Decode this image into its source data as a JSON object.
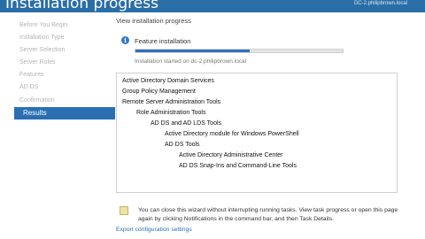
{
  "window": {
    "title": "Installation progress",
    "server": "DC-2.philipbrown.local"
  },
  "sidebar": {
    "items": [
      {
        "label": "Before You Begin"
      },
      {
        "label": "Installation Type"
      },
      {
        "label": "Server Selection"
      },
      {
        "label": "Server Roles"
      },
      {
        "label": "Features"
      },
      {
        "label": "AD DS"
      },
      {
        "label": "Confirmation"
      },
      {
        "label": "Results"
      }
    ],
    "active_index": 7
  },
  "main": {
    "heading": "View installation progress",
    "progress": {
      "label": "Feature installation",
      "percent": 55,
      "status": "Installation started on dc-2.philipbrown.local"
    },
    "features": [
      {
        "label": "Active Directory Domain Services",
        "level": 0
      },
      {
        "label": "Group Policy Management",
        "level": 0
      },
      {
        "label": "Remote Server Administration Tools",
        "level": 0
      },
      {
        "label": "Role Administration Tools",
        "level": 1
      },
      {
        "label": "AD DS and AD LDS Tools",
        "level": 2
      },
      {
        "label": "Active Directory module for Windows PowerShell",
        "level": 3
      },
      {
        "label": "AD DS Tools",
        "level": 3
      },
      {
        "label": "Active Directory Administrative Center",
        "level": 4
      },
      {
        "label": "AD DS Snap-Ins and Command-Line Tools",
        "level": 4
      }
    ],
    "note": "You can close this wizard without interrupting running tasks. View task progress or open this page again by clicking Notifications in the command bar, and then Task Details.",
    "export_link": "Export configuration settings"
  },
  "colors": {
    "accent": "#2a6fb2",
    "header": "#2a6ea7",
    "progress": "#2f72b5"
  },
  "icons": {
    "progress": "info-icon",
    "note": "note-icon"
  }
}
